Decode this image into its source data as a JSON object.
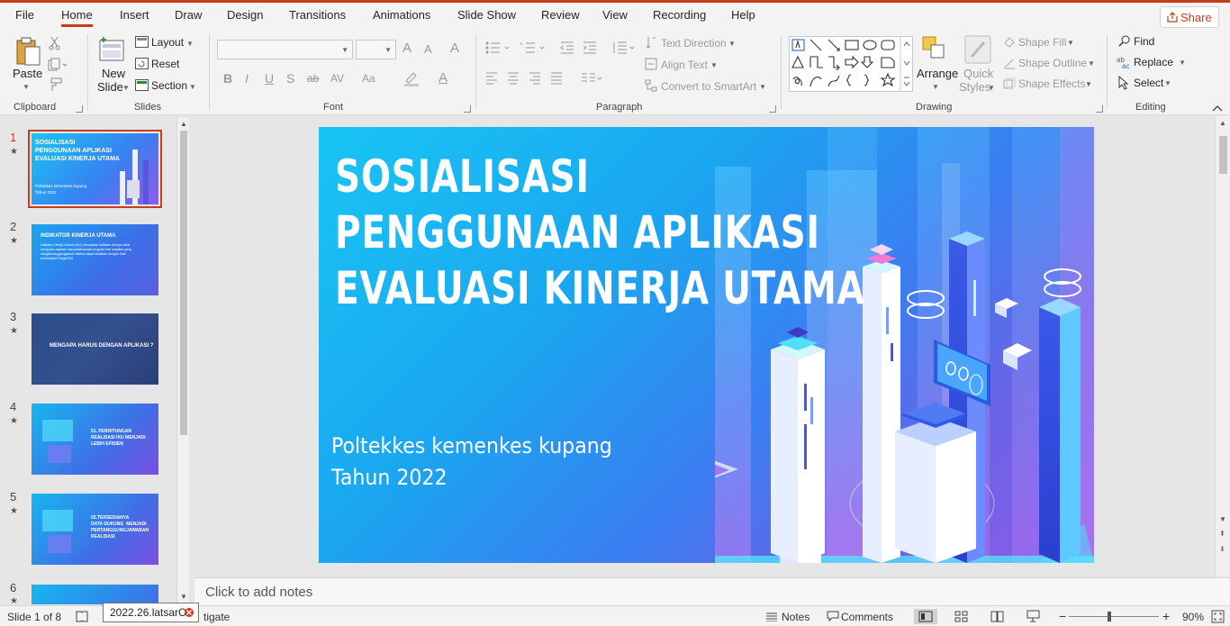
{
  "tabs": [
    "File",
    "Home",
    "Insert",
    "Draw",
    "Design",
    "Transitions",
    "Animations",
    "Slide Show",
    "Review",
    "View",
    "Recording",
    "Help"
  ],
  "active_tab": "Home",
  "share_label": "Share",
  "ribbon": {
    "clipboard": {
      "paste": "Paste",
      "group": "Clipboard"
    },
    "slides": {
      "new_slide_1": "New",
      "new_slide_2": "Slide",
      "layout": "Layout",
      "reset": "Reset",
      "section": "Section",
      "group": "Slides"
    },
    "font": {
      "bold": "B",
      "italic": "I",
      "underline": "U",
      "shadow": "S",
      "strike": "ab",
      "spacing": "AV",
      "case": "Aa",
      "grow": "A",
      "shrink": "A",
      "clear": "A",
      "color": "A",
      "group": "Font"
    },
    "paragraph": {
      "text_direction": "Text Direction",
      "align_text": "Align Text",
      "smartart": "Convert to SmartArt",
      "group": "Paragraph"
    },
    "drawing": {
      "arrange": "Arrange",
      "quick_styles_1": "Quick",
      "quick_styles_2": "Styles",
      "shape_fill": "Shape Fill",
      "shape_outline": "Shape Outline",
      "shape_effects": "Shape Effects",
      "group": "Drawing"
    },
    "editing": {
      "find": "Find",
      "replace": "Replace",
      "select": "Select",
      "group": "Editing"
    }
  },
  "thumbnails": [
    {
      "num": "1",
      "title": "SOSIALISASI\nPENGGUNAAN APLIKASI\nEVALUASI KINERJA UTAMA",
      "sub": "Poltekkes kemenkes kupang\nTahun 2022"
    },
    {
      "num": "2",
      "title": "INDIKATOR KINERJA UTAMA",
      "sub": "Indikator Kinerja Utama (IKU) merupakan indikator kinerja untuk mengukur capaian atau pelaksanaan program dan kegiatan yang menjadi tanggungjawab institusi dapat dikaitkan dengan hasil berbasiskan Target IKU"
    },
    {
      "num": "3",
      "title": "MENGAPA HARUS DENGAN APLIKASI ?",
      "sub": ""
    },
    {
      "num": "4",
      "title": "01. PERHITUNGAN\nREALISASI IKU MENJADI\nLEBIH EFISIEN",
      "sub": ""
    },
    {
      "num": "5",
      "title": "02.TERSEDIANYA\nDATA DUKUNG  MENJADI\nPERTANGGUNGJAWABAN\nREALISASI",
      "sub": ""
    },
    {
      "num": "6",
      "title": "",
      "sub": ""
    }
  ],
  "slide": {
    "title_lines": [
      "SOSIALISASI",
      "PENGGUNAAN APLIKASI",
      "EVALUASI KINERJA UTAMA"
    ],
    "subtitle_lines": [
      "Poltekkes kemenkes kupang",
      "Tahun 2022"
    ]
  },
  "notes_placeholder": "Click to add notes",
  "status": {
    "slide_of": "Slide 1 of 8",
    "tooltip": "2022.26.latsarC",
    "investigate": "tigate",
    "notes": "Notes",
    "comments": "Comments",
    "zoom": "90%"
  },
  "colors": {
    "accent": "#c43e1c",
    "slide_start": "#19c5f4",
    "slide_end": "#8f5ce8"
  }
}
